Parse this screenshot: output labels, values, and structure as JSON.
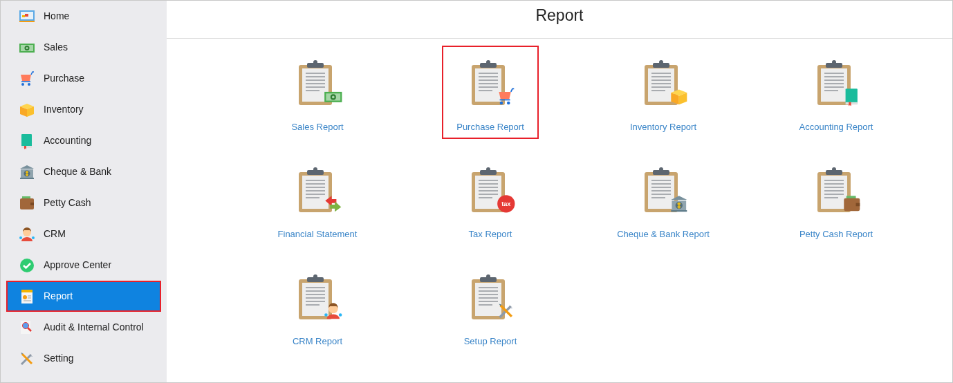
{
  "sidebar": {
    "items": [
      {
        "label": "Home",
        "kind": "monitor",
        "selected": false,
        "highlighted": false
      },
      {
        "label": "Sales",
        "kind": "money",
        "selected": false,
        "highlighted": false
      },
      {
        "label": "Purchase",
        "kind": "cart",
        "selected": false,
        "highlighted": false
      },
      {
        "label": "Inventory",
        "kind": "box",
        "selected": false,
        "highlighted": false
      },
      {
        "label": "Accounting",
        "kind": "book",
        "selected": false,
        "highlighted": false
      },
      {
        "label": "Cheque & Bank",
        "kind": "bank",
        "selected": false,
        "highlighted": false
      },
      {
        "label": "Petty Cash",
        "kind": "wallet",
        "selected": false,
        "highlighted": false
      },
      {
        "label": "CRM",
        "kind": "person",
        "selected": false,
        "highlighted": false
      },
      {
        "label": "Approve Center",
        "kind": "check",
        "selected": false,
        "highlighted": false
      },
      {
        "label": "Report",
        "kind": "document",
        "selected": true,
        "highlighted": true
      },
      {
        "label": "Audit & Internal Control",
        "kind": "magnifier",
        "selected": false,
        "highlighted": false
      },
      {
        "label": "Setting",
        "kind": "tools",
        "selected": false,
        "highlighted": false
      }
    ]
  },
  "page": {
    "title": "Report"
  },
  "reports": [
    {
      "label": "Sales Report",
      "kind": "money",
      "highlighted": false
    },
    {
      "label": "Purchase Report",
      "kind": "cart",
      "highlighted": true
    },
    {
      "label": "Inventory Report",
      "kind": "box",
      "highlighted": false
    },
    {
      "label": "Accounting Report",
      "kind": "book",
      "highlighted": false
    },
    {
      "label": "Financial Statement",
      "kind": "exchange",
      "highlighted": false
    },
    {
      "label": "Tax Report",
      "kind": "tax",
      "badge": "tax",
      "highlighted": false
    },
    {
      "label": "Cheque & Bank Report",
      "kind": "bank",
      "highlighted": false
    },
    {
      "label": "Petty Cash Report",
      "kind": "wallet",
      "highlighted": false
    },
    {
      "label": "CRM Report",
      "kind": "person",
      "highlighted": false
    },
    {
      "label": "Setup Report",
      "kind": "tools",
      "highlighted": false
    }
  ]
}
